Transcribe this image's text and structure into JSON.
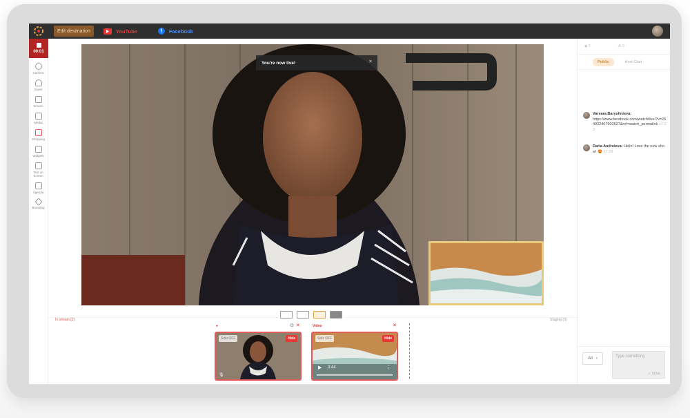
{
  "topbar": {
    "edit_destination": "Edit destination",
    "destinations": [
      {
        "label": "YouTube",
        "icon": "youtube-icon",
        "color": "#e53935"
      },
      {
        "label": "Facebook",
        "icon": "facebook-icon",
        "color": "#1877f2"
      }
    ]
  },
  "sidebar": {
    "timer": "00:01",
    "items": [
      {
        "label": "Camera",
        "icon": "camera-icon"
      },
      {
        "label": "Guest",
        "icon": "guest-icon"
      },
      {
        "label": "Screen",
        "icon": "screen-icon"
      },
      {
        "label": "Media",
        "icon": "media-icon"
      },
      {
        "label": "Shopping",
        "icon": "shopping-icon"
      },
      {
        "label": "Widgets",
        "icon": "widgets-icon"
      },
      {
        "label": "Text on Screen",
        "icon": "text-icon"
      },
      {
        "label": "Agenda",
        "icon": "agenda-icon"
      },
      {
        "label": "Branding",
        "icon": "branding-icon"
      }
    ]
  },
  "stage": {
    "toast": "You're now live!",
    "toast_close": "×"
  },
  "bottom": {
    "in_stream": "In stream (2)",
    "staging": "Staging (0)",
    "tiles": [
      {
        "header": "",
        "solo": "Solo OFF",
        "hide": "Hide"
      },
      {
        "header": "Video",
        "solo": "Solo OFF",
        "hide": "Hide",
        "time": "0:44"
      }
    ]
  },
  "chat": {
    "viewers": "0",
    "reactions": "0",
    "tabs": [
      "Public",
      "Host Chat"
    ],
    "messages": [
      {
        "name": "Varvara Baryshnieva:",
        "text": "https://www.facebook.com/watch/live/?v=264932467903527&ref=watch_permalink",
        "time": "17:23"
      },
      {
        "name": "Daria Andreieva:",
        "text": "Hello! Love the new show! 😍",
        "time": "17:23"
      }
    ],
    "filter": "All",
    "input_placeholder": "Type something",
    "send": "SEND"
  },
  "colors": {
    "live_red": "#b32525",
    "accent_orange": "#e8a040",
    "tile_border": "#e45a5a"
  }
}
